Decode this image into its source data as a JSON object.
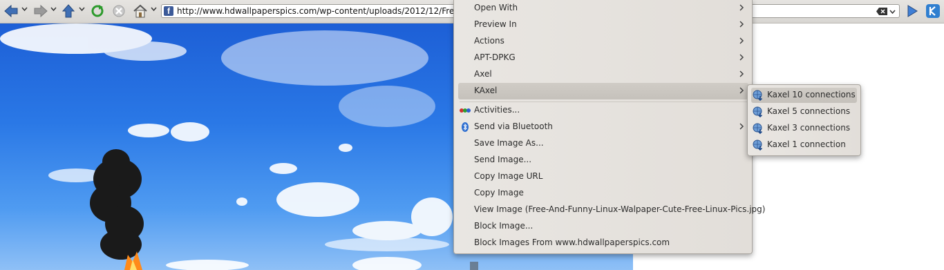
{
  "toolbar": {
    "url": "http://www.hdwallpaperspics.com/wp-content/uploads/2012/12/Free-And-Funny-Linux-Walpaper-Cute-Free-Linux-Pics.jpg",
    "favicon_letter": "f",
    "icons": [
      "back-icon",
      "forward-icon",
      "up-icon",
      "reload-icon",
      "stop-icon",
      "home-icon",
      "clear-icon",
      "go-icon",
      "kde-icon"
    ]
  },
  "context_menu": {
    "items": [
      {
        "label": "Open With",
        "submenu": true
      },
      {
        "label": "Preview In",
        "submenu": true
      },
      {
        "label": "Actions",
        "submenu": true
      },
      {
        "label": "APT-DPKG",
        "submenu": true
      },
      {
        "label": "Axel",
        "submenu": true
      },
      {
        "label": "KAxel",
        "submenu": true,
        "highlighted": true
      },
      {
        "label": "Activities...",
        "icon": "activities-icon"
      },
      {
        "label": "Send via Bluetooth",
        "icon": "bluetooth-icon",
        "submenu": true
      },
      {
        "label": "Save Image As..."
      },
      {
        "label": "Send Image..."
      },
      {
        "label": "Copy Image URL"
      },
      {
        "label": "Copy Image"
      },
      {
        "label": "View Image (Free-And-Funny-Linux-Walpaper-Cute-Free-Linux-Pics.jpg)"
      },
      {
        "label": "Block Image..."
      },
      {
        "label": "Block Images From www.hdwallpaperspics.com"
      }
    ]
  },
  "kaxel_submenu": {
    "items": [
      {
        "label": "Kaxel 10 connections",
        "highlighted": true
      },
      {
        "label": "Kaxel 5 connections"
      },
      {
        "label": "Kaxel 3 connections"
      },
      {
        "label": "Kaxel 1 connection"
      }
    ]
  },
  "colors": {
    "sky": "#2a78e6",
    "menu_background": "#e6e3df",
    "highlight": "#cbc7c1"
  }
}
